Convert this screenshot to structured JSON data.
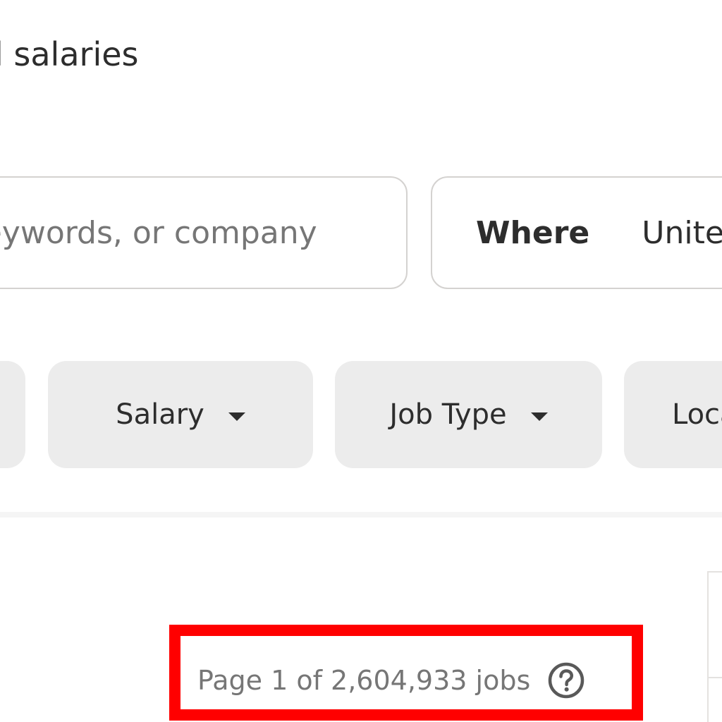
{
  "header": {
    "headline": "l salaries"
  },
  "search": {
    "what_placeholder": "Job title, keywords, or company",
    "where_label": "Where",
    "where_value": "United States"
  },
  "filters": {
    "items": [
      {
        "label": ""
      },
      {
        "label": "Salary",
        "icon": "caret-down-icon"
      },
      {
        "label": "Job Type",
        "icon": "caret-down-icon"
      },
      {
        "label": "Location",
        "icon": "caret-down-icon"
      }
    ]
  },
  "results": {
    "count_text": "Page 1 of 2,604,933 jobs",
    "help_icon": "help-circle-icon"
  },
  "colors": {
    "highlight": "#ff0000",
    "chip_bg": "#ececec",
    "text": "#2d2d2d",
    "muted_text": "#767676",
    "border": "#d4d2d0"
  }
}
